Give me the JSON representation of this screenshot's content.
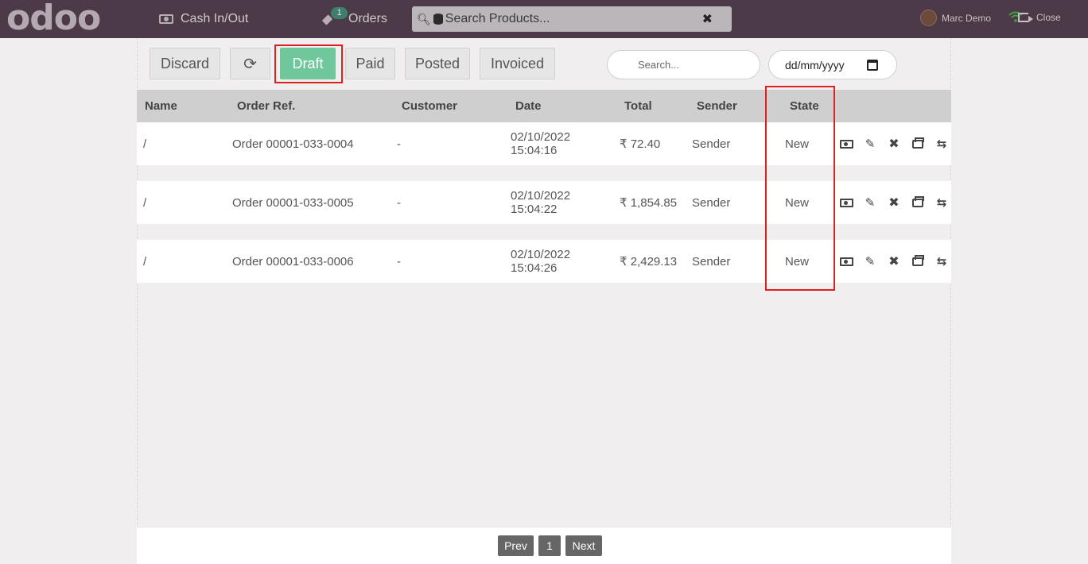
{
  "topbar": {
    "logo": "odoo",
    "cash_label": "Cash In/Out",
    "orders_label": "Orders",
    "orders_badge": "1",
    "search_placeholder": "Search Products...",
    "clear_symbol": "✖",
    "user_name": "Marc Demo",
    "close_label": "Close"
  },
  "toolbar": {
    "discard": "Discard",
    "refresh_symbol": "⟳",
    "draft": "Draft",
    "paid": "Paid",
    "posted": "Posted",
    "invoiced": "Invoiced",
    "search_placeholder": "Search...",
    "date_placeholder": "dd/mm/yyyy"
  },
  "table": {
    "headers": [
      "Name",
      "Order Ref.",
      "Customer",
      "Date",
      "Total",
      "Sender",
      "State"
    ],
    "rows": [
      {
        "name": "/",
        "ref": "Order 00001-033-0004",
        "customer": "-",
        "date": "02/10/2022",
        "time": "15:04:16",
        "total": "₹ 72.40",
        "sender": "Sender",
        "state": "New"
      },
      {
        "name": "/",
        "ref": "Order 00001-033-0005",
        "customer": "-",
        "date": "02/10/2022",
        "time": "15:04:22",
        "total": "₹ 1,854.85",
        "sender": "Sender",
        "state": "New"
      },
      {
        "name": "/",
        "ref": "Order 00001-033-0006",
        "customer": "-",
        "date": "02/10/2022",
        "time": "15:04:26",
        "total": "₹ 2,429.13",
        "sender": "Sender",
        "state": "New"
      }
    ],
    "action_icons": [
      "money-icon",
      "edit-icon",
      "cancel-icon",
      "print-icon",
      "retweet-icon"
    ]
  },
  "pager": {
    "prev": "Prev",
    "page": "1",
    "next": "Next"
  },
  "colors": {
    "topbar": "#4c3a48",
    "draft_active": "#6ec89b",
    "highlight": "#e02020"
  }
}
